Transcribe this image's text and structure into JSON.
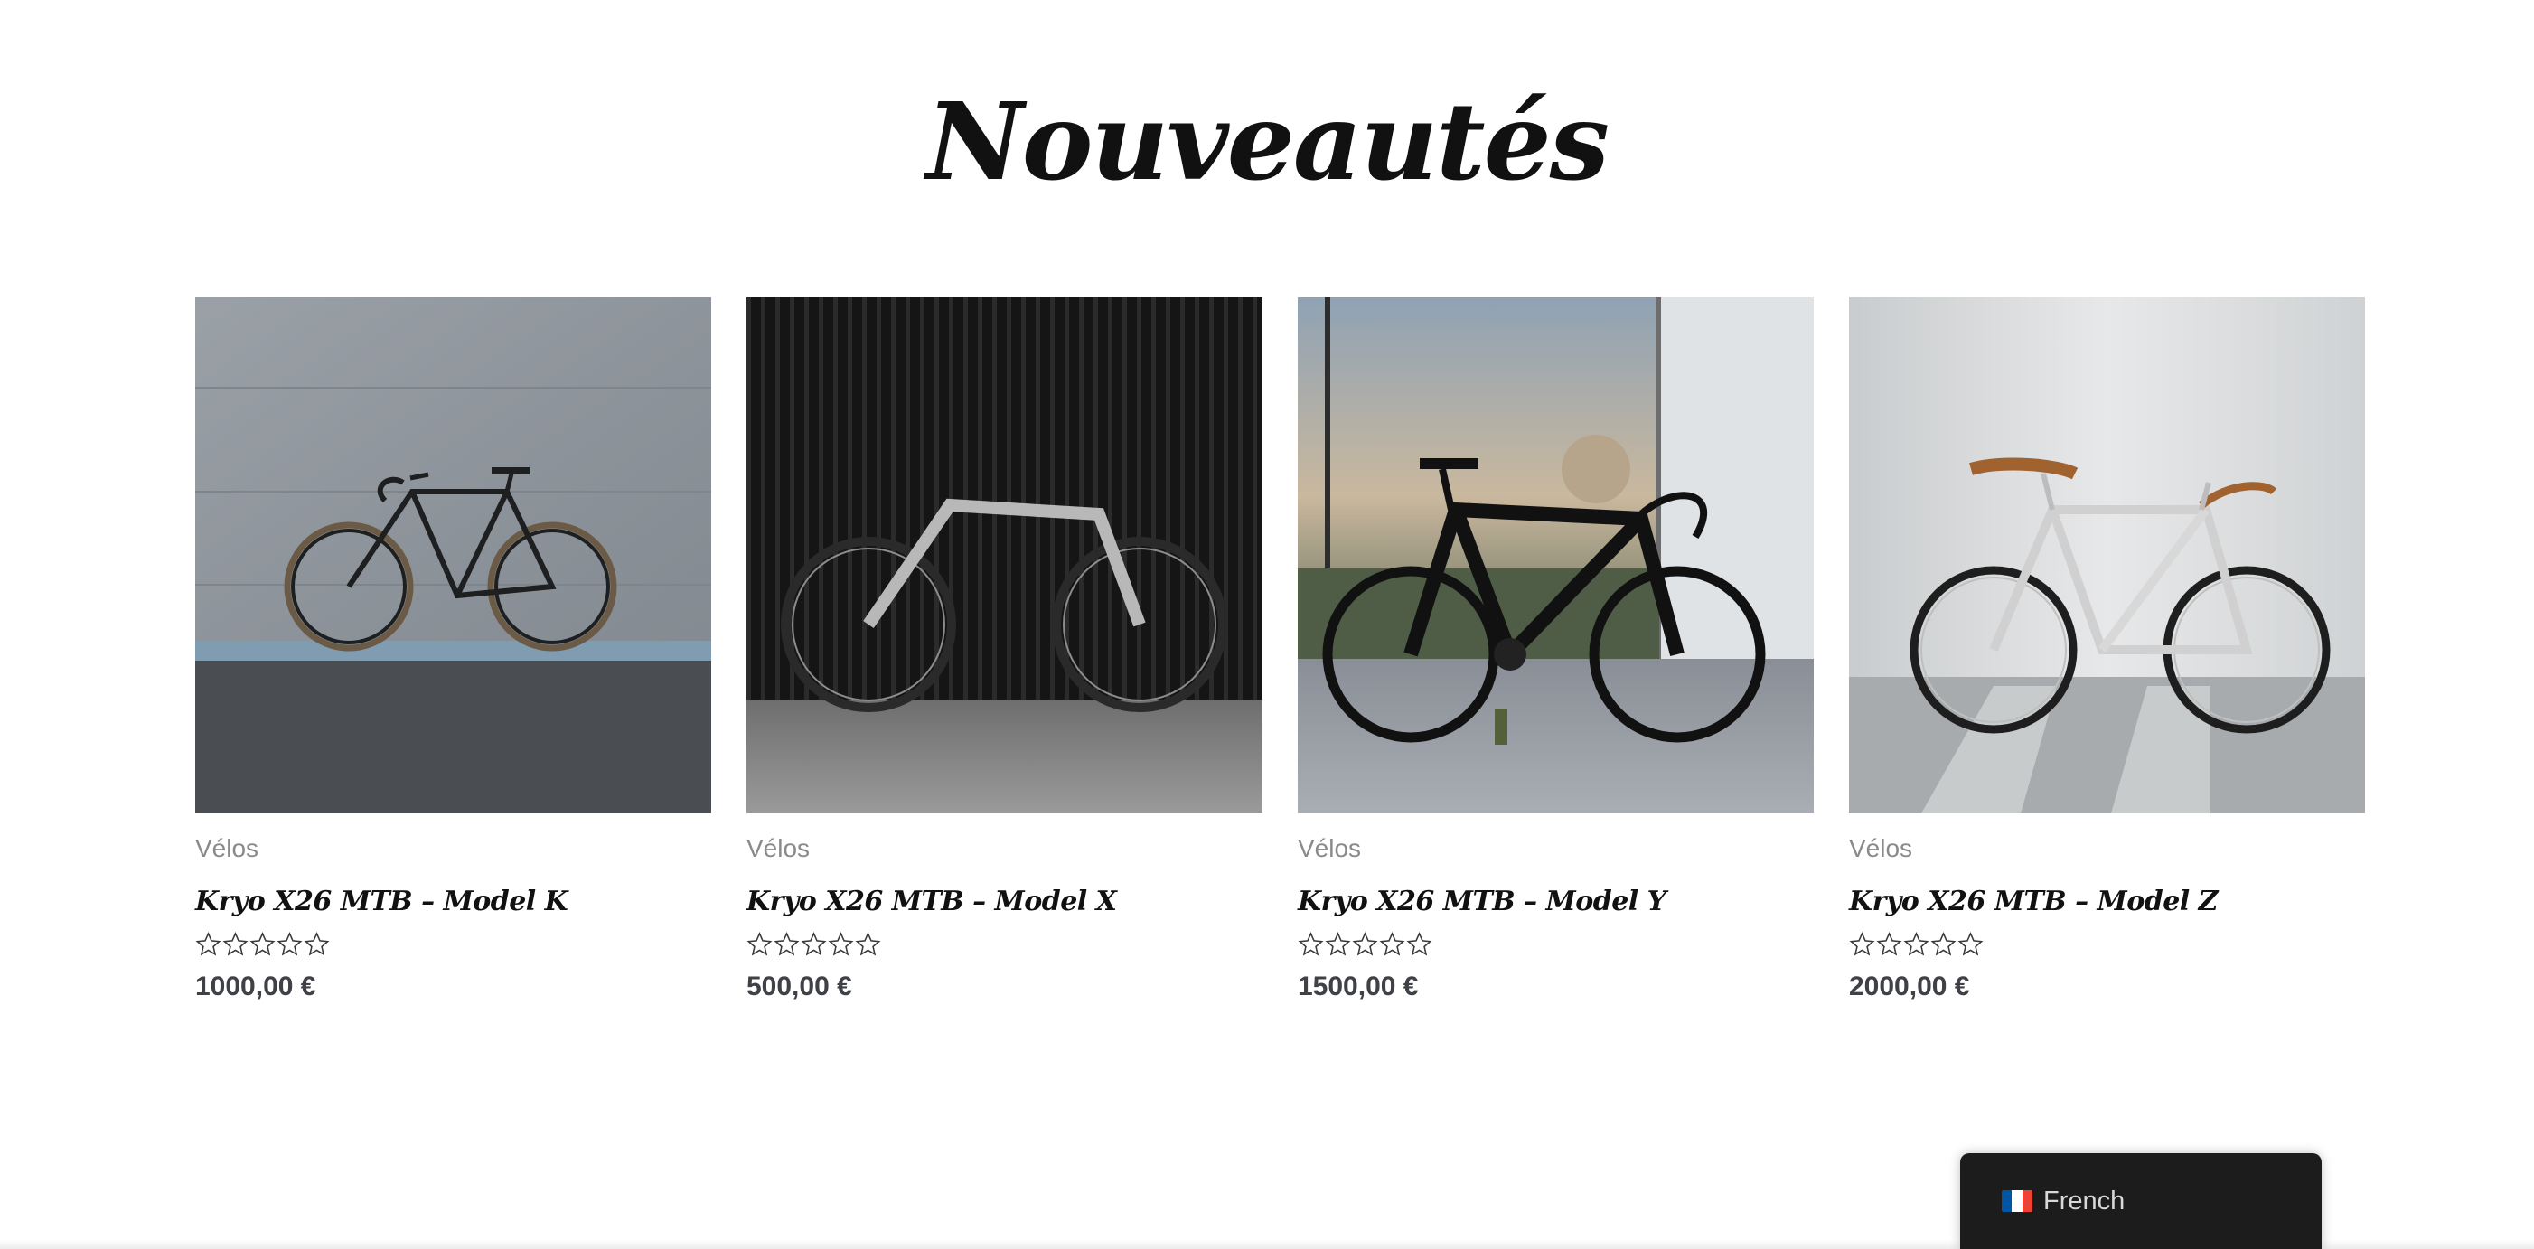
{
  "section": {
    "title": "Nouveautés"
  },
  "products": [
    {
      "category": "Vélos",
      "title": "Kryo X26 MTB – Model K",
      "price": "1000,00 €",
      "rating": 0
    },
    {
      "category": "Vélos",
      "title": "Kryo X26 MTB – Model X",
      "price": "500,00 €",
      "rating": 0
    },
    {
      "category": "Vélos",
      "title": "Kryo X26 MTB – Model Y",
      "price": "1500,00 €",
      "rating": 0
    },
    {
      "category": "Vélos",
      "title": "Kryo X26 MTB – Model Z",
      "price": "2000,00 €",
      "rating": 0
    }
  ],
  "language_switcher": {
    "label": "French",
    "flag_icon": "france-flag-icon",
    "flag_colors": [
      "#0055a4",
      "#ffffff",
      "#ef4135"
    ]
  },
  "colors": {
    "title": "#111111",
    "category": "#8a8a8a",
    "price": "#3f4147",
    "switcher_bg": "#1c1c1c"
  }
}
